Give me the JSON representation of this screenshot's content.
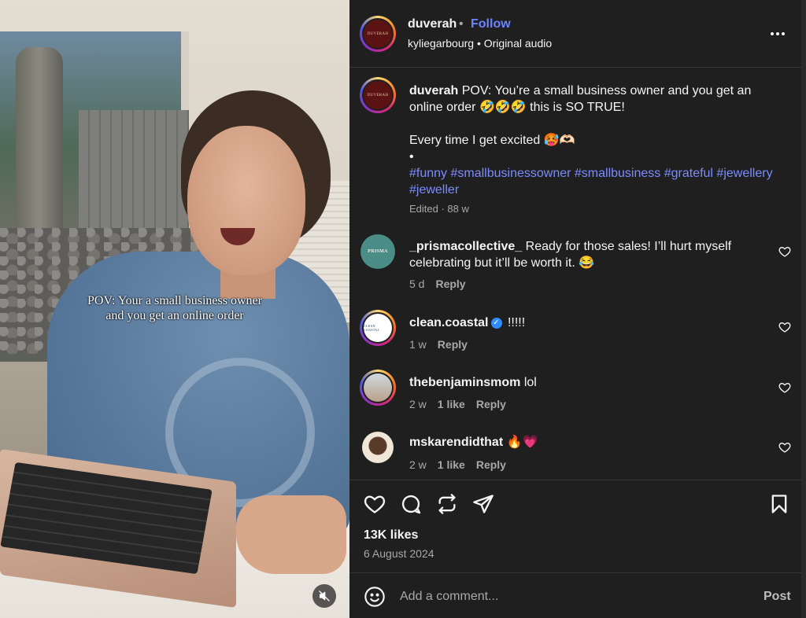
{
  "video": {
    "overlay_caption_line1": "POV: Your a small business owner",
    "overlay_caption_line2": "and you get an online order",
    "mute_icon": "speaker-muted-icon"
  },
  "header": {
    "username": "duverah",
    "separator": "•",
    "follow_label": "Follow",
    "audio_user": "kyliegarbourg",
    "audio_label": "Original audio",
    "avatar_text": "DUVERAH"
  },
  "caption": {
    "username": "duverah",
    "line1": "POV: You’re a small business owner and you get an online order 🤣🤣🤣 this is SO TRUE!",
    "line2": "Every time I get excited 🥵🫶🏻",
    "bullet": "•",
    "hashtags": "#funny #smallbusinessowner #smallbusiness #grateful #jewellery #jeweller",
    "meta": "Edited · 88 w"
  },
  "comments": [
    {
      "username": "_prismacollective_",
      "text": "Ready for those sales! I’ll hurt myself celebrating but it’ll be worth it. 😂",
      "time": "5 d",
      "likes": "",
      "reply": "Reply",
      "avatar_text": "PRISMA"
    },
    {
      "username": "clean.coastal",
      "verified": true,
      "text": "!!!!!",
      "time": "1 w",
      "likes": "",
      "reply": "Reply",
      "avatar_text": "CLEAN COASTAL"
    },
    {
      "username": "thebenjaminsmom",
      "text": "lol",
      "time": "2 w",
      "likes": "1 like",
      "reply": "Reply"
    },
    {
      "username": "mskarendidthat",
      "text": "🔥💗",
      "time": "2 w",
      "likes": "1 like",
      "reply": "Reply"
    }
  ],
  "footer": {
    "likes": "13K likes",
    "date": "6 August 2024",
    "comment_placeholder": "Add a comment...",
    "post_label": "Post"
  },
  "colors": {
    "panel_bg": "#1f1f1f",
    "link_blue": "#6d84ff",
    "hashtag_blue": "#7b8cff",
    "muted_text": "#a8a8a8"
  }
}
